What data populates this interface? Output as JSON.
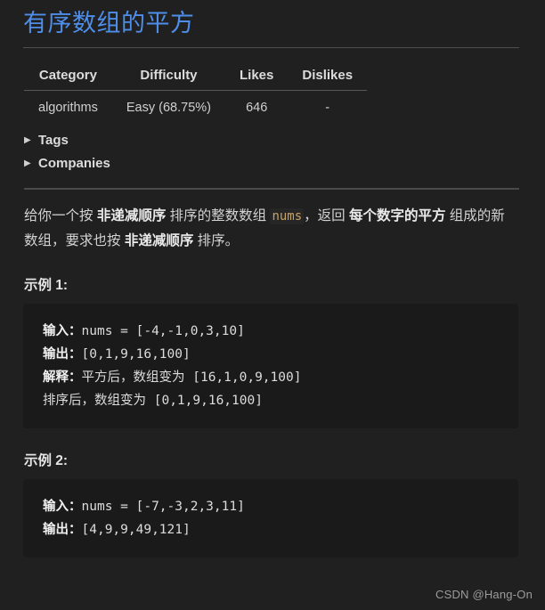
{
  "problem": {
    "title": "有序数组的平方"
  },
  "meta_table": {
    "headers": [
      "Category",
      "Difficulty",
      "Likes",
      "Dislikes"
    ],
    "rows": [
      [
        "algorithms",
        "Easy (68.75%)",
        "646",
        "-"
      ]
    ]
  },
  "collapsibles": [
    {
      "label": "Tags",
      "marker": "▶",
      "icon": "triangle-right-icon",
      "expanded": false
    },
    {
      "label": "Companies",
      "marker": "▶",
      "icon": "triangle-right-icon",
      "expanded": false
    }
  ],
  "description": {
    "part1": "给你一个按 ",
    "bold1": "非递减顺序",
    "part2": " 排序的整数数组 ",
    "code1": "nums",
    "part3": "，返回 ",
    "bold2": "每个数字的平方",
    "part4": " 组成的新数组，要求也按 ",
    "bold3": "非递减顺序",
    "part5": " 排序。"
  },
  "examples": [
    {
      "heading": "示例 1:",
      "lines": [
        {
          "label": "输入：",
          "value": "nums = [-4,-1,0,3,10]"
        },
        {
          "label": "输出：",
          "value": "[0,1,9,16,100]"
        },
        {
          "label": "解释：",
          "value": "平方后，数组变为 [16,1,0,9,100]"
        },
        {
          "label": "",
          "value": "排序后，数组变为 [0,1,9,16,100]"
        }
      ]
    },
    {
      "heading": "示例 2:",
      "lines": [
        {
          "label": "输入：",
          "value": "nums = [-7,-3,2,3,11]"
        },
        {
          "label": "输出：",
          "value": "[4,9,9,49,121]"
        }
      ]
    }
  ],
  "watermark": {
    "text": "CSDN @Hang-On"
  },
  "colors": {
    "page_background": "#202020",
    "code_background": "#1a1a1a",
    "title_link": "#4e8ee8",
    "body_text": "#d2d2d2",
    "inline_code": "#c8a164",
    "divider": "#4e4e4e"
  }
}
